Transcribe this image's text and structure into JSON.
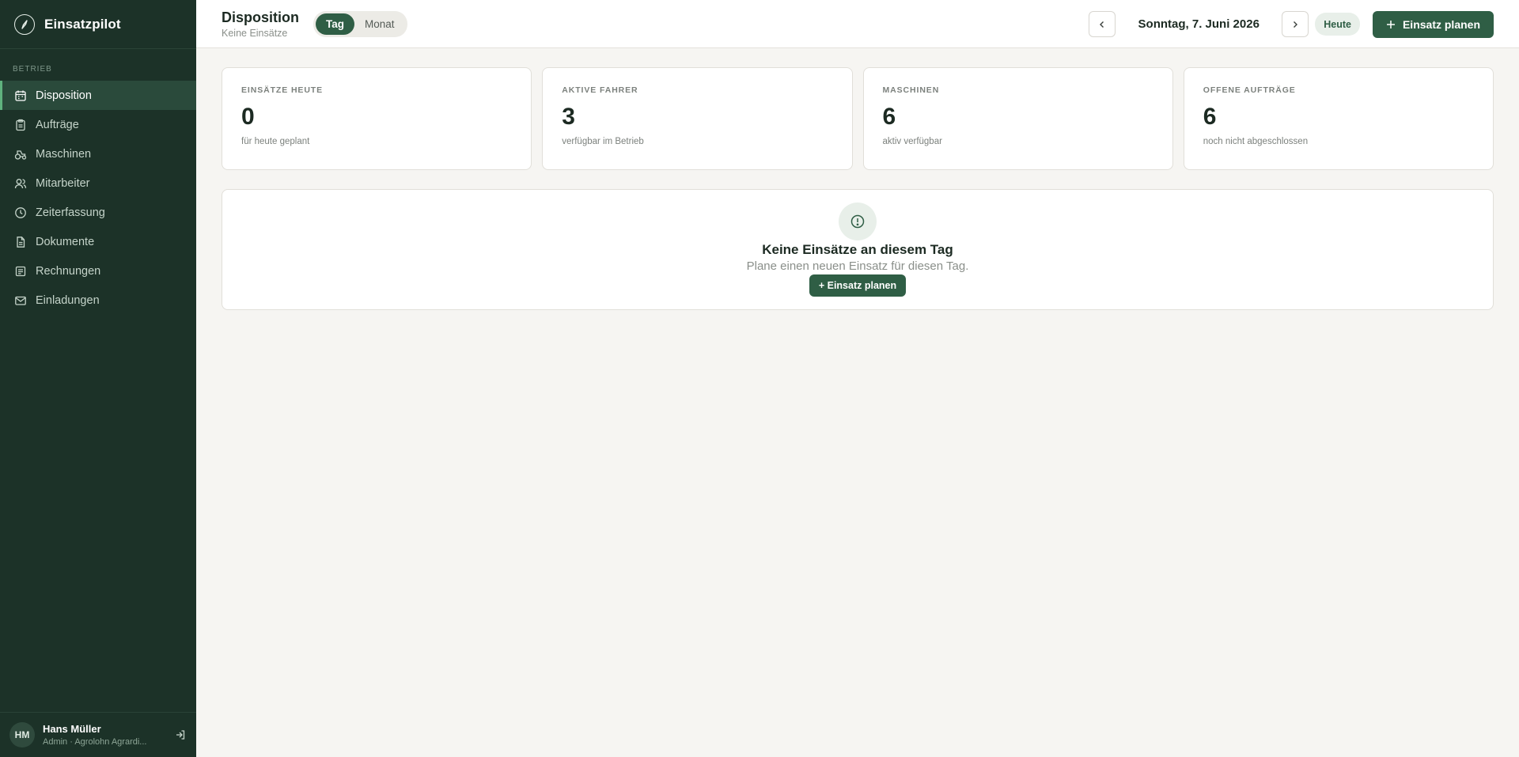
{
  "app": {
    "name": "Einsatzpilot",
    "logo_icon": "compass-icon"
  },
  "sidebar": {
    "section_label": "Betrieb",
    "items": [
      {
        "label": "Disposition",
        "icon": "calendar-icon",
        "active": true
      },
      {
        "label": "Aufträge",
        "icon": "clipboard-icon",
        "active": false
      },
      {
        "label": "Maschinen",
        "icon": "tractor-icon",
        "active": false
      },
      {
        "label": "Mitarbeiter",
        "icon": "users-icon",
        "active": false
      },
      {
        "label": "Zeiterfassung",
        "icon": "clock-icon",
        "active": false
      },
      {
        "label": "Dokumente",
        "icon": "file-icon",
        "active": false
      },
      {
        "label": "Rechnungen",
        "icon": "receipt-icon",
        "active": false
      },
      {
        "label": "Einladungen",
        "icon": "mail-icon",
        "active": false
      }
    ],
    "user": {
      "initials": "HM",
      "name": "Hans Müller",
      "role": "Admin · Agrolohn Agrardi..."
    }
  },
  "header": {
    "title": "Disposition",
    "subtitle": "Keine Einsätze",
    "view_toggle": {
      "options": [
        "Tag",
        "Monat"
      ],
      "selected": "Tag"
    },
    "date": "Sonntag, 7. Juni 2026",
    "today_label": "Heute",
    "plan_label": "Einsatz planen"
  },
  "stats": [
    {
      "label": "Einsätze heute",
      "value": "0",
      "sub": "für heute geplant"
    },
    {
      "label": "Aktive Fahrer",
      "value": "3",
      "sub": "verfügbar im Betrieb"
    },
    {
      "label": "Maschinen",
      "value": "6",
      "sub": "aktiv verfügbar"
    },
    {
      "label": "Offene Aufträge",
      "value": "6",
      "sub": "noch nicht abgeschlossen"
    }
  ],
  "empty_state": {
    "icon": "alert-circle-icon",
    "title": "Keine Einsätze an diesem Tag",
    "text": "Plane einen neuen Einsatz für diesen Tag.",
    "button_label": "+ Einsatz planen"
  },
  "colors": {
    "sidebar_bg": "#1c3228",
    "accent": "#2f5e45",
    "active_indicator": "#5fb27e",
    "page_bg": "#f6f5f2"
  }
}
